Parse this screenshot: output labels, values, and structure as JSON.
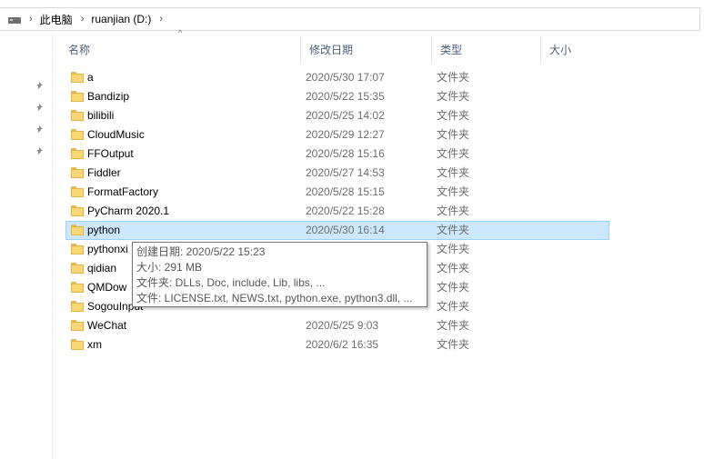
{
  "address": {
    "drive_icon": "drive-icon",
    "crumbs": [
      "此电脑",
      "ruanjian (D:)"
    ],
    "separator": "›"
  },
  "columns": {
    "name": "名称",
    "date": "修改日期",
    "type": "类型",
    "size": "大小",
    "sort_indicator": "^"
  },
  "quick_access_pins": 4,
  "files": [
    {
      "name": "a",
      "date": "2020/5/30 17:07",
      "type": "文件夹",
      "selected": false
    },
    {
      "name": "Bandizip",
      "date": "2020/5/22 15:35",
      "type": "文件夹",
      "selected": false
    },
    {
      "name": "bilibili",
      "date": "2020/5/25 14:02",
      "type": "文件夹",
      "selected": false
    },
    {
      "name": "CloudMusic",
      "date": "2020/5/29 12:27",
      "type": "文件夹",
      "selected": false
    },
    {
      "name": "FFOutput",
      "date": "2020/5/28 15:16",
      "type": "文件夹",
      "selected": false
    },
    {
      "name": "Fiddler",
      "date": "2020/5/27 14:53",
      "type": "文件夹",
      "selected": false
    },
    {
      "name": "FormatFactory",
      "date": "2020/5/28 15:15",
      "type": "文件夹",
      "selected": false
    },
    {
      "name": "PyCharm 2020.1",
      "date": "2020/5/22 15:28",
      "type": "文件夹",
      "selected": false
    },
    {
      "name": "python",
      "date": "2020/5/30 16:14",
      "type": "文件夹",
      "selected": true
    },
    {
      "name": "pythonxi",
      "date": "",
      "type": "文件夹",
      "selected": false
    },
    {
      "name": "qidian",
      "date": "",
      "type": "文件夹",
      "selected": false
    },
    {
      "name": "QMDow",
      "date": "",
      "type": "文件夹",
      "selected": false
    },
    {
      "name": "SogouInput",
      "date": "",
      "type": "文件夹",
      "selected": false
    },
    {
      "name": "WeChat",
      "date": "2020/5/25 9:03",
      "type": "文件夹",
      "selected": false
    },
    {
      "name": "xm",
      "date": "2020/6/2 16:35",
      "type": "文件夹",
      "selected": false
    }
  ],
  "tooltip": {
    "created": "创建日期: 2020/5/22 15:23",
    "size": "大小: 291 MB",
    "folders": "文件夹: DLLs, Doc, include, Lib, libs, ...",
    "files": "文件: LICENSE.txt, NEWS.txt, python.exe, python3.dll, ..."
  },
  "colors": {
    "selection": "#cce8ff",
    "selection_border": "#99d1ff",
    "header_text": "#4c607a",
    "folder_yellow": "#f8d775"
  }
}
